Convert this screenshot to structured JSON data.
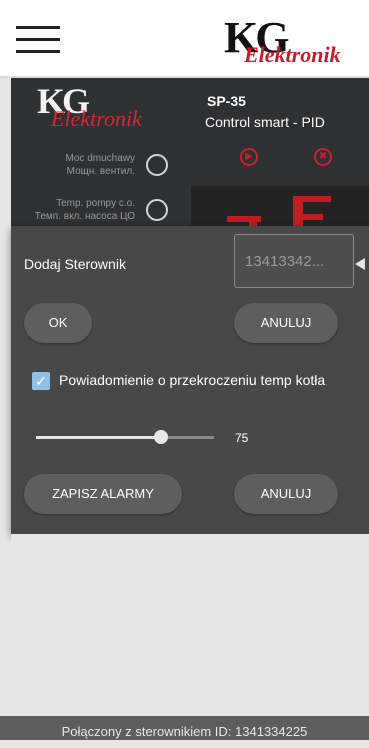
{
  "header": {
    "brand_kg": "KG",
    "brand_elektronik": "Elektronik"
  },
  "controller_panel": {
    "logo_kg": "KG",
    "logo_elektronik": "Elektronik",
    "model": "SP-35",
    "subtitle": "Control smart - PID",
    "items": [
      {
        "label1": "Moc dmuchawy",
        "label2": "Мощн. вентил."
      },
      {
        "label1": "Temp. pompy c.o.",
        "label2": "Темп. вкл. насоса ЦО"
      }
    ],
    "accent_color": "#c82030"
  },
  "dialog": {
    "add_label": "Dodaj Sterownik",
    "id_value": "13413342...",
    "ok_label": "OK",
    "cancel_label": "ANULUJ",
    "alarm_checkbox": {
      "checked": true,
      "label": "Powiadomienie o przekroczeniu temp kotła"
    },
    "slider": {
      "value": 75,
      "fraction": 0.7
    },
    "save_alarms_label": "ZAPISZ ALARMY",
    "cancel2_label": "ANULUJ"
  },
  "statusbar": {
    "text": "Połączony z sterownikiem ID: 1341334225"
  }
}
